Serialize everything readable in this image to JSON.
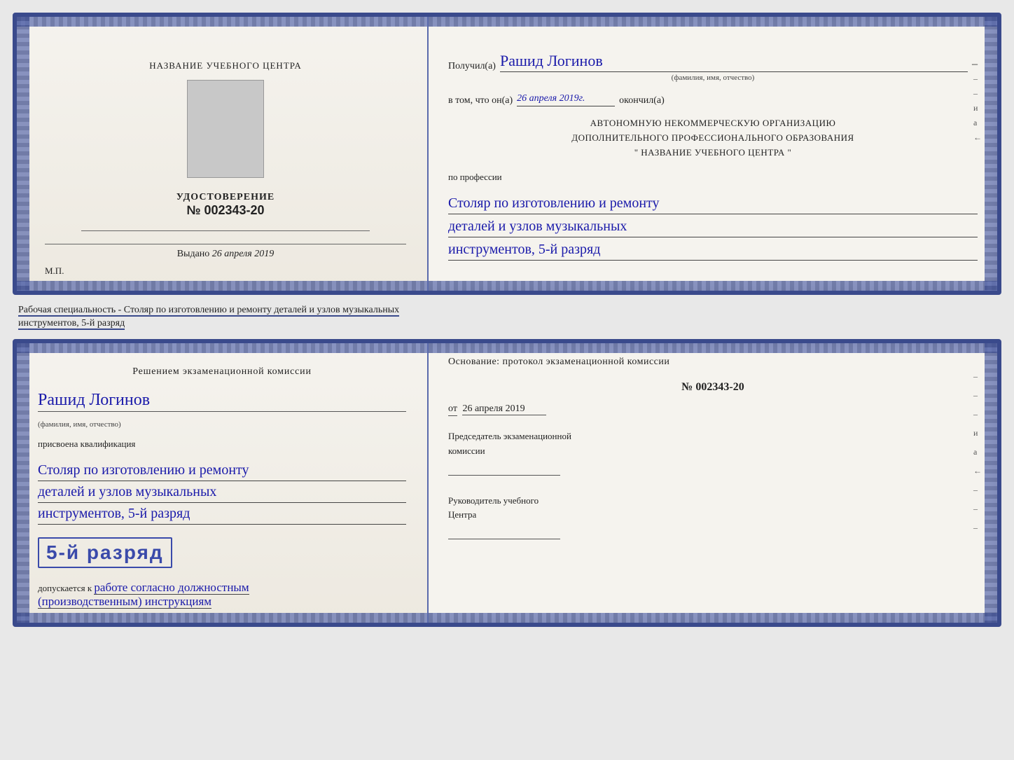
{
  "top_card": {
    "left": {
      "training_center_label": "НАЗВАНИЕ УЧЕБНОГО ЦЕНТРА",
      "udostoverenie_label": "УДОСТОВЕРЕНИЕ",
      "number_prefix": "№",
      "number": "002343-20",
      "vydano_label": "Выдано",
      "vydano_date": "26 апреля 2019",
      "mp_label": "М.П."
    },
    "right": {
      "poluchil_label": "Получил(а)",
      "recipient_name": "Рашид Логинов",
      "fio_hint": "(фамилия, имя, отчество)",
      "dash": "–",
      "vtom_label": "в том, что он(а)",
      "vtom_date": "26 апреля 2019г.",
      "okonchil_label": "окончил(а)",
      "org_line1": "АВТОНОМНУЮ НЕКОММЕРЧЕСКУЮ ОРГАНИЗАЦИЮ",
      "org_line2": "ДОПОЛНИТЕЛЬНОГО ПРОФЕССИОНАЛЬНОГО ОБРАЗОВАНИЯ",
      "org_name": "\"  НАЗВАНИЕ УЧЕБНОГО ЦЕНТРА  \"",
      "po_professii": "по профессии",
      "profession_line1": "Столяр по изготовлению и ремонту",
      "profession_line2": "деталей и узлов музыкальных",
      "profession_line3": "инструментов, 5-й разряд",
      "right_marks": [
        "–",
        "–",
        "–",
        "и",
        "а",
        "←"
      ]
    }
  },
  "between": {
    "text_normal": "Рабочая специальность - Столяр по изготовлению и ремонту деталей и узлов музыкальных",
    "text_underlined": "инструментов, 5-й разряд"
  },
  "bottom_card": {
    "left": {
      "resheniem_label": "Решением  экзаменационной  комиссии",
      "name": "Рашид Логинов",
      "fio_hint": "(фамилия, имя, отчество)",
      "prisvoena_label": "присвоена квалификация",
      "qual_line1": "Столяр по изготовлению и ремонту",
      "qual_line2": "деталей и узлов музыкальных",
      "qual_line3": "инструментов, 5-й разряд",
      "razryad_big": "5-й разряд",
      "dopusk_label": "допускается к",
      "dopusk_value": "работе согласно должностным",
      "dopusk_value2": "(производственным) инструкциям"
    },
    "right": {
      "osnovaniye_label": "Основание: протокол экзаменационной  комиссии",
      "number_prefix": "№",
      "number": "002343-20",
      "ot_label": "от",
      "ot_date": "26 апреля 2019",
      "chairman_label": "Председатель экзаменационной",
      "chairman_label2": "комиссии",
      "rukovoditel_label": "Руководитель учебного",
      "rukovoditel_label2": "Центра",
      "right_marks": [
        "–",
        "–",
        "–",
        "и",
        "а",
        "←",
        "–",
        "–",
        "–"
      ]
    }
  }
}
